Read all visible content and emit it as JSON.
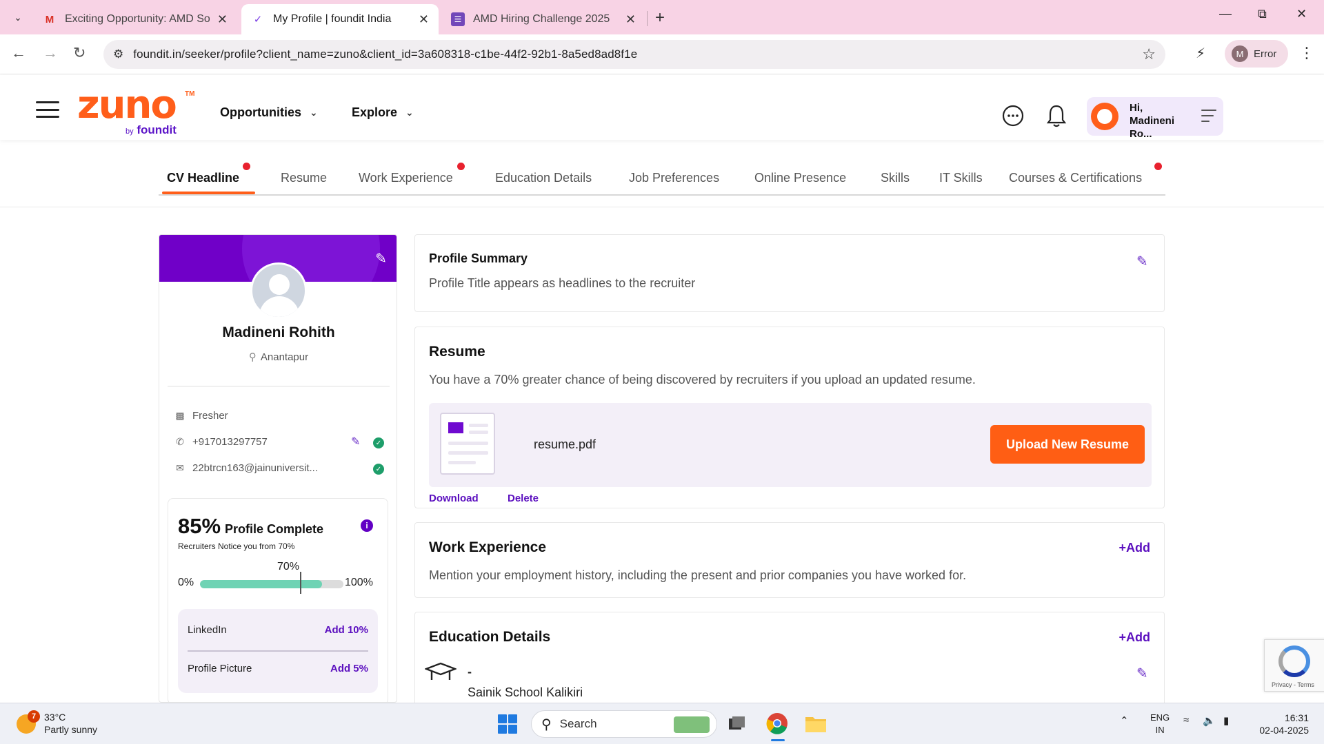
{
  "browser": {
    "tabs": [
      {
        "title": "Exciting Opportunity: AMD Soft",
        "favicon": "gmail-icon"
      },
      {
        "title": "My Profile | foundit India",
        "favicon": "foundit-icon",
        "active": true
      },
      {
        "title": "AMD Hiring Challenge 2025",
        "favicon": "forms-icon"
      }
    ],
    "url": "foundit.in/seeker/profile?client_name=zuno&client_id=3a608318-c1be-44f2-92b1-8a5ed8ad8f1e",
    "profile_initial": "M",
    "profile_label": "Error"
  },
  "header": {
    "logo_word": "zuno",
    "logo_tm": "TM",
    "logo_by": "by",
    "logo_brand": "foundit",
    "nav": [
      "Opportunities",
      "Explore"
    ],
    "user_greeting": "Hi, Madineni Ro..."
  },
  "profile_tabs": [
    {
      "label": "CV Headline",
      "active": true,
      "dot": true
    },
    {
      "label": "Resume"
    },
    {
      "label": "Work Experience",
      "dot": true
    },
    {
      "label": "Education Details"
    },
    {
      "label": "Job Preferences"
    },
    {
      "label": "Online Presence"
    },
    {
      "label": "Skills"
    },
    {
      "label": "IT Skills"
    },
    {
      "label": "Courses & Certifications",
      "dot": true
    }
  ],
  "profile_card": {
    "name": "Madineni Rohith",
    "location": "Anantapur",
    "experience": "Fresher",
    "phone": "+917013297757",
    "email": "22btrcn163@jainuniversit...",
    "completion": {
      "percent": "85%",
      "label": "Profile Complete",
      "note": "Recruiters Notice you from 70%",
      "marker": "70%",
      "min": "0%",
      "max": "100%",
      "fill_fraction": 0.85,
      "marker_fraction": 0.7
    },
    "suggestions": [
      {
        "label": "LinkedIn",
        "action": "Add 10%"
      },
      {
        "label": "Profile Picture",
        "action": "Add 5%"
      }
    ]
  },
  "summary": {
    "title": "Profile Summary",
    "text": "Profile Title appears as headlines to the recruiter"
  },
  "resume": {
    "title": "Resume",
    "text": "You have a 70% greater chance of being discovered by recruiters if you upload an updated resume.",
    "file": "resume.pdf",
    "upload_label": "Upload New Resume",
    "download_label": "Download",
    "delete_label": "Delete"
  },
  "work": {
    "title": "Work Experience",
    "add_label": "+Add",
    "text": "Mention your employment history, including the present and prior companies you have worked for."
  },
  "education": {
    "title": "Education Details",
    "add_label": "+Add",
    "degree": "-",
    "school": "Sainik School Kalikiri"
  },
  "recaptcha": {
    "text": "Privacy - Terms"
  },
  "taskbar": {
    "weather_badge": "7",
    "temp": "33°C",
    "condition": "Partly sunny",
    "search_placeholder": "Search",
    "lang_top": "ENG",
    "lang_bottom": "IN",
    "time": "16:31",
    "date": "02-04-2025"
  },
  "colors": {
    "brand_orange": "#ff5e1a",
    "brand_purple": "#7000c8",
    "tabbar_pink": "#f8d3e5",
    "progress_green": "#6fd3b4"
  }
}
